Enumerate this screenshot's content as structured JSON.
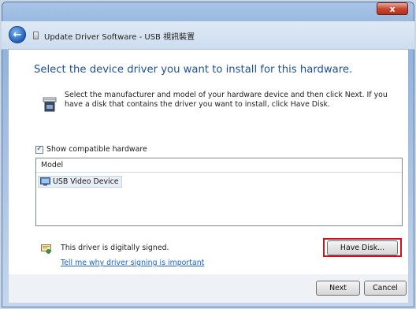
{
  "window": {
    "title": "Update Driver Software - USB 視訊裝置",
    "close_glyph": "x"
  },
  "nav": {
    "back_glyph": "←"
  },
  "main": {
    "heading": "Select the device driver you want to install for this hardware.",
    "instructions": "Select the manufacturer and model of your hardware device and then click Next. If you have a disk that contains the driver you want to install, click Have Disk.",
    "show_compatible_label": "Show compatible hardware",
    "show_compatible_checked": true,
    "check_glyph": "✓",
    "model_list": {
      "header": "Model",
      "items": [
        {
          "label": "USB Video Device",
          "selected": true
        }
      ]
    },
    "signed_text": "This driver is digitally signed.",
    "help_link": "Tell me why driver signing is important",
    "have_disk_label": "Have Disk..."
  },
  "footer": {
    "next_label": "Next",
    "cancel_label": "Cancel"
  },
  "colors": {
    "heading": "#1e4d9b",
    "link": "#1a63c6",
    "highlight_outline": "#d0121b",
    "selected_item_bg": "#e8eef6"
  },
  "icons": {
    "back": "back-arrow-icon",
    "hardware": "hardware-device-icon",
    "list_item": "monitor-device-icon",
    "signed": "signed-driver-icon",
    "close": "close-icon"
  }
}
